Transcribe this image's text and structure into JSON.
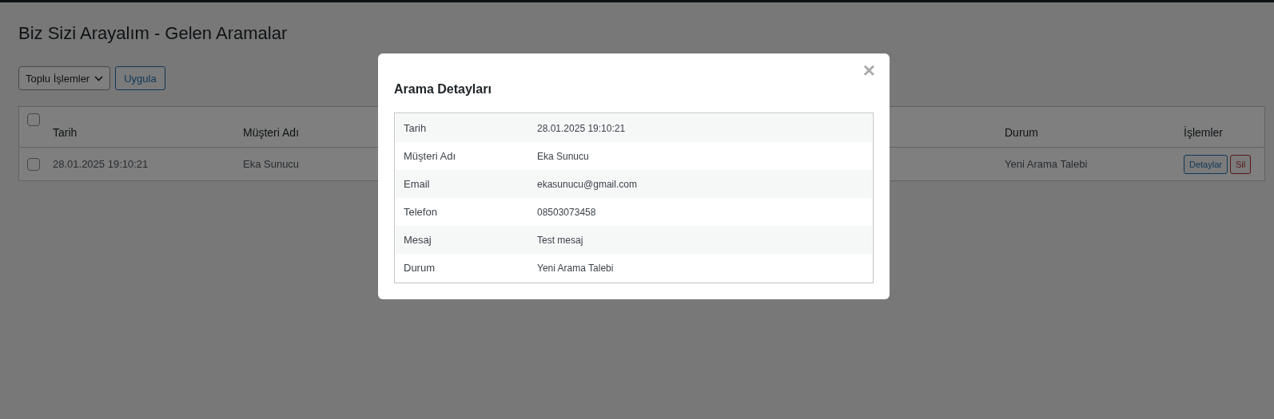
{
  "page": {
    "title": "Biz Sizi Arayalım - Gelen Aramalar"
  },
  "bulk_actions": {
    "select": "Toplu İşlemler",
    "apply_button": "Uygula"
  },
  "table": {
    "select_all": {
      "checked": false
    },
    "columns": [
      {
        "label": "Tarih"
      },
      {
        "label": "Müşteri Adı"
      },
      {
        "label": "Durum"
      },
      {
        "label": "İşlemler"
      }
    ],
    "rows": [
      {
        "checked": false,
        "date": "28.01.2025 19:10:21",
        "name": "Eka Sunucu",
        "status": "Yeni Arama Talebi",
        "actions": [
          {
            "label": "Detaylar",
            "kind": "primary"
          },
          {
            "label": "Sil",
            "kind": "danger"
          }
        ]
      }
    ]
  },
  "modal": {
    "title": "Arama Detayları",
    "close": "×",
    "fields": [
      {
        "label": "Tarih",
        "value": "28.01.2025 19:10:21"
      },
      {
        "label": "Müşteri Adı",
        "value": "Eka Sunucu"
      },
      {
        "label": "Email",
        "value": "ekasunucu@gmail.com"
      },
      {
        "label": "Telefon",
        "value": "08503073458"
      },
      {
        "label": "Mesaj",
        "value": "Test mesaj"
      },
      {
        "label": "Durum",
        "value": "Yeni Arama Talebi"
      }
    ]
  }
}
